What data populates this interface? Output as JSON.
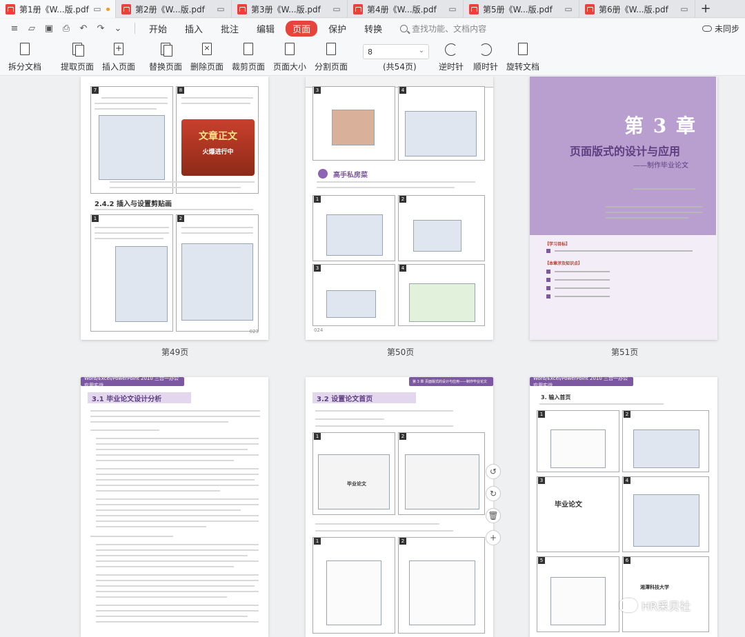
{
  "tabs": [
    {
      "label": "第1册《W...版.pdf",
      "active": true,
      "modified": true
    },
    {
      "label": "第2册《W...版.pdf"
    },
    {
      "label": "第3册《W...版.pdf"
    },
    {
      "label": "第4册《W...版.pdf"
    },
    {
      "label": "第5册《W...版.pdf"
    },
    {
      "label": "第6册《W...版.pdf"
    }
  ],
  "new_tab": "+",
  "menu": [
    "开始",
    "插入",
    "批注",
    "编辑",
    "页面",
    "保护",
    "转换"
  ],
  "active_menu": "页面",
  "search_placeholder": "查找功能、文档内容",
  "sync_label": "未同步",
  "toolbar": {
    "split": "拆分文档",
    "extract": "提取页面",
    "insert": "插入页面",
    "replace": "替换页面",
    "delete": "删除页面",
    "crop": "裁剪页面",
    "size": "页面大小",
    "divide": "分割页面",
    "page_input": "8",
    "page_total": "(共54页)",
    "rotate_ccw": "逆时针",
    "rotate_cw": "顺时针",
    "rotate_doc": "旋转文档"
  },
  "pages": {
    "p49": {
      "label": "第49页",
      "sec_title": "2.4.2  插入与设置剪贴画",
      "banner": "文章正文",
      "banner_sub": "火爆进行中",
      "footer": "023"
    },
    "p50": {
      "label": "第50页",
      "tip_title": "高手私房菜",
      "footer": "024"
    },
    "p51": {
      "label": "第51页",
      "chapter": "第 3 章",
      "title": "页面版式的设计与应用",
      "subtitle": "——制作毕业论文",
      "learn_h": "【学习目标】",
      "key_h": "【本章涉及知识点】"
    },
    "p52": {
      "band": "Word/Excel/PowerPoint 2010 三合一办公应用实战",
      "section": "3.1  毕业论文设计分析"
    },
    "p53": {
      "band": "第 3 章  页面版式的设计与应用——制作毕业论文",
      "section": "3.2  设置论文首页",
      "cover_text": "毕业论文"
    },
    "p54": {
      "band": "Word/Excel/PowerPoint 2010 三合一办公应用实战",
      "section": "3. 输入首页",
      "cover_text": "毕业论文",
      "cover_school": "湘潭科技大学"
    }
  },
  "watermark": "HR采贝社",
  "colors": {
    "accent": "#e8433b",
    "chapter_purple": "#7d58a2"
  }
}
